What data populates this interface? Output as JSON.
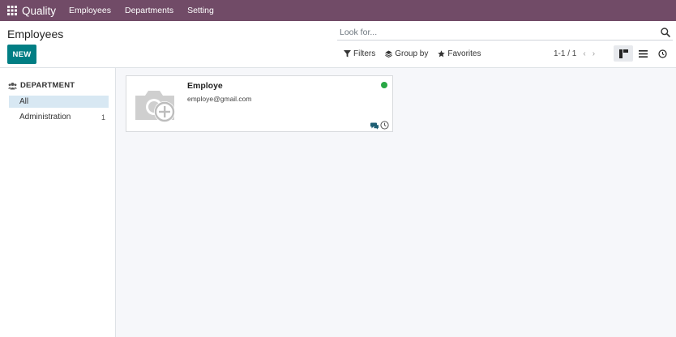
{
  "navbar": {
    "brand": "Quality",
    "items": [
      {
        "label": "Employees"
      },
      {
        "label": "Departments"
      },
      {
        "label": "Setting"
      }
    ]
  },
  "control": {
    "title": "Employees",
    "new_label": "NEW",
    "search_placeholder": "Look for...",
    "filters_label": "Filters",
    "groupby_label": "Group by",
    "favorites_label": "Favorites",
    "pager": "1-1 / 1"
  },
  "sidebar": {
    "header": "DEPARTMENT",
    "items": [
      {
        "label": "All",
        "count": ""
      },
      {
        "label": "Administration",
        "count": "1"
      }
    ]
  },
  "card": {
    "name": "Employe",
    "email": "employe@gmail.com",
    "status_color": "#28a745"
  },
  "colors": {
    "brand": "#714b67",
    "primary_button": "#017e84"
  }
}
